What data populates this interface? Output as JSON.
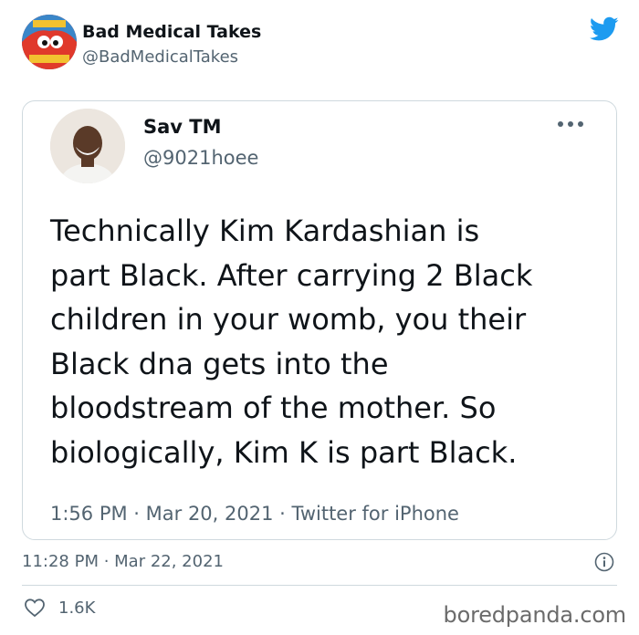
{
  "outer_tweet": {
    "author_name": "Bad Medical Takes",
    "author_handle": "@BadMedicalTakes",
    "timestamp": "11:28 PM · Mar 22, 2021",
    "likes": "1.6K"
  },
  "quoted_tweet": {
    "author_name": "Sav TM",
    "author_handle": "@9021hoee",
    "text_lines": [
      "Technically Kim Kardashian is",
      "part Black. After carrying 2 Black",
      "children in your womb, you their",
      "Black dna gets into the",
      "bloodstream of the mother. So",
      "biologically, Kim K is part Black."
    ],
    "meta": "1:56 PM · Mar 20, 2021 · Twitter for iPhone"
  },
  "watermark": "boredpanda.com",
  "colors": {
    "twitter_blue": "#1d9bf0",
    "muted_text": "#536471",
    "border": "#cfd9de"
  },
  "icons": [
    "twitter-bird-icon",
    "more-options-icon",
    "info-icon",
    "heart-icon"
  ]
}
